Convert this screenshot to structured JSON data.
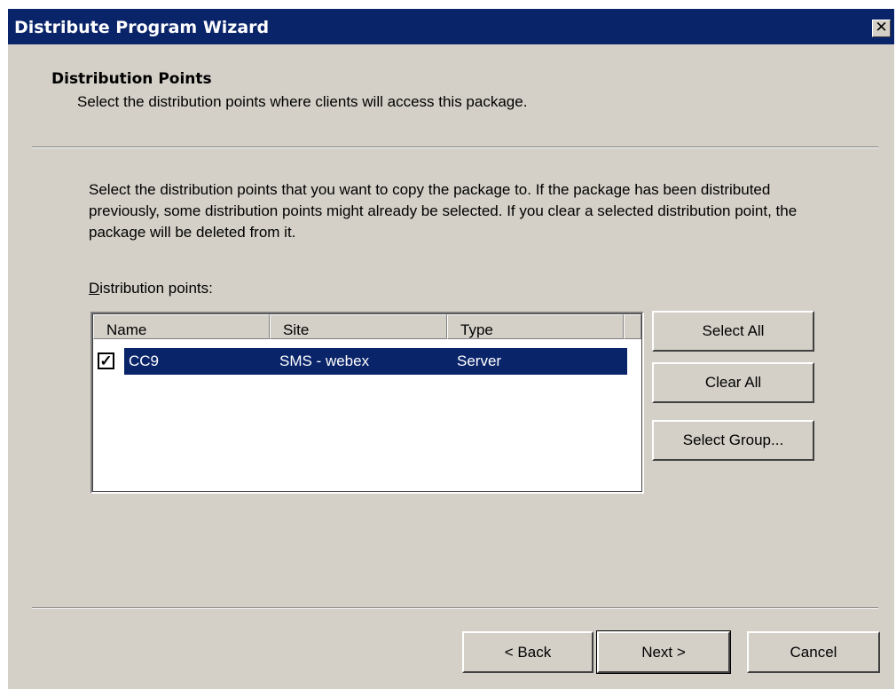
{
  "window": {
    "title": "Distribute Program Wizard",
    "close_glyph": "✕"
  },
  "header": {
    "title": "Distribution Points",
    "subtitle": "Select the distribution points where clients will access this package."
  },
  "body": {
    "description": "Select the distribution points that you want to copy the package to. If the package has been distributed previously, some distribution points might already be selected. If you clear a selected distribution point, the package will be deleted from it.",
    "list_label": "Distribution points:"
  },
  "list": {
    "columns": [
      "Name",
      "Site",
      "Type"
    ],
    "rows": [
      {
        "checked": true,
        "name": "CC9",
        "site": "SMS - webex",
        "type": "Server"
      }
    ]
  },
  "buttons": {
    "select_all": "Select All",
    "clear_all": "Clear All",
    "select_group": "Select Group...",
    "back": "< Back",
    "next": "Next >",
    "cancel": "Cancel"
  },
  "colors": {
    "titlebar": "#0a246a",
    "face": "#d4d0c8",
    "selection": "#0a246a"
  }
}
